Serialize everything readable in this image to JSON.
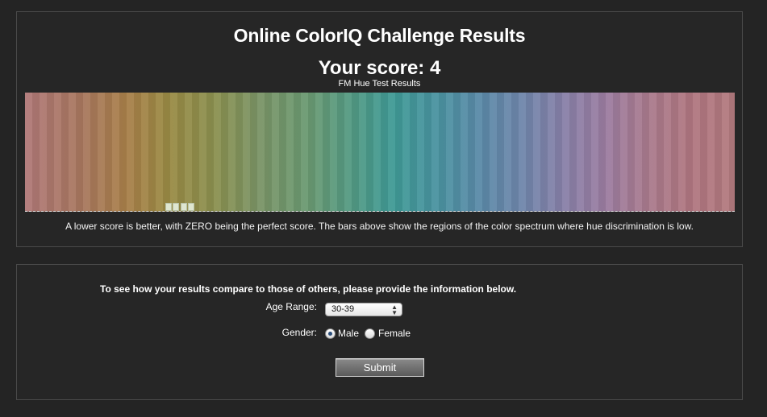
{
  "results": {
    "title": "Online ColorIQ Challenge Results",
    "score_text": "Your score: 4",
    "chart_title": "FM Hue Test Results",
    "note": "A lower score is better, with ZERO being the perfect score. The bars above show the regions of the color spectrum where hue discrimination is low."
  },
  "chart_data": {
    "type": "bar",
    "title": "FM Hue Test Results",
    "bins_total": 96,
    "errors": [
      {
        "bin": 19,
        "value": 1
      },
      {
        "bin": 20,
        "value": 1
      },
      {
        "bin": 21,
        "value": 1
      },
      {
        "bin": 22,
        "value": 1
      }
    ],
    "score": 4,
    "background": "hue spectrum red-orange-yellow-green-cyan-blue-violet-red"
  },
  "form": {
    "intro": "To see how your results compare to those of others, please provide the information below.",
    "age_label": "Age Range:",
    "age_value": "30-39",
    "gender_label": "Gender:",
    "gender_options": [
      "Male",
      "Female"
    ],
    "gender_selected": "Male",
    "submit_label": "Submit"
  }
}
